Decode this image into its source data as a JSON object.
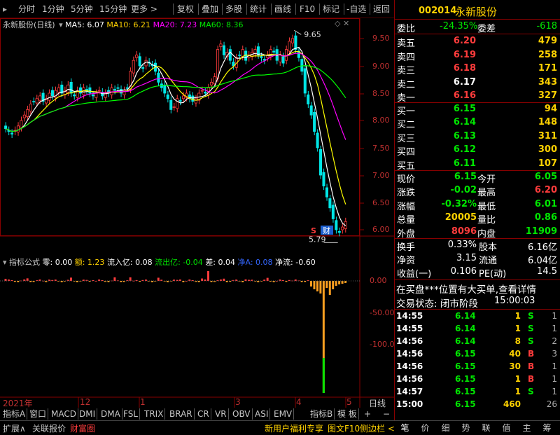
{
  "toolbar": {
    "items": [
      "分时",
      "1分钟",
      "5分钟",
      "15分钟",
      "更多 >",
      "复权",
      "叠加",
      "多股",
      "统计",
      "画线",
      "F10",
      "标记",
      "-自选",
      "返回"
    ]
  },
  "chart_header": {
    "name": "永新股份(日线)",
    "ma5": "MA5: 6.07",
    "ma10": "MA10: 6.21",
    "ma20": "MA20: 7.23",
    "ma60": "MA60: 8.36"
  },
  "indicator_header": {
    "name": "指标公式",
    "ling": "零: 0.00",
    "e": "额: 1.23",
    "liuru": "流入亿: 0.08",
    "liuchu": "流出亿: -0.04",
    "cha": "差: 0.04",
    "jingA": "净A: 0.08",
    "jingliu": "净流: -0.60"
  },
  "price_axis": [
    "9.50",
    "9.00",
    "8.50",
    "8.00",
    "7.50",
    "7.00",
    "6.50",
    "6.00"
  ],
  "ind_axis": [
    "0.00",
    "-50.00",
    "-100.0"
  ],
  "annotations": {
    "high": "9.65",
    "low": "5.79",
    "s_marker": "S",
    "cai_marker": "财"
  },
  "time_axis": {
    "year": "2021年",
    "m12": "12",
    "m1": "1",
    "m3": "3",
    "m4": "4",
    "m5": "5",
    "daily": "日线"
  },
  "bottom_tabs": [
    "指标A",
    "窗口",
    "MACD",
    "DMI",
    "DMA",
    "FSL",
    "TRIX",
    "BRAR",
    "CR",
    "VR",
    "OBV",
    "ASI",
    "EMV",
    "指标B",
    "模 板",
    "+",
    "−"
  ],
  "status_left": [
    "扩展∧",
    "关联报价",
    "财富圈"
  ],
  "status_mid": [
    "新用户福利专享",
    "图文F10",
    "侧边栏 <"
  ],
  "status_right": [
    "笔",
    "价",
    "细",
    "势",
    "联",
    "值",
    "主",
    "筹"
  ],
  "stock": {
    "code": "002014",
    "name": "永新股份"
  },
  "quote": {
    "weibi_label": "委比",
    "weibi": "-24.35%",
    "weicha_label": "委差",
    "weicha": "-618",
    "asks": [
      {
        "label": "卖五",
        "price": "6.20",
        "vol": "479"
      },
      {
        "label": "卖四",
        "price": "6.19",
        "vol": "258"
      },
      {
        "label": "卖三",
        "price": "6.18",
        "vol": "171"
      },
      {
        "label": "卖二",
        "price": "6.17",
        "vol": "343"
      },
      {
        "label": "卖一",
        "price": "6.16",
        "vol": "327"
      }
    ],
    "bids": [
      {
        "label": "买一",
        "price": "6.15",
        "vol": "94"
      },
      {
        "label": "买二",
        "price": "6.14",
        "vol": "148"
      },
      {
        "label": "买三",
        "price": "6.13",
        "vol": "311"
      },
      {
        "label": "买四",
        "price": "6.12",
        "vol": "300"
      },
      {
        "label": "买五",
        "price": "6.11",
        "vol": "107"
      }
    ],
    "stats": [
      {
        "l1": "现价",
        "v1": "6.15",
        "l2": "今开",
        "v2": "6.05",
        "c1": "green",
        "c2": "green"
      },
      {
        "l1": "涨跌",
        "v1": "-0.02",
        "l2": "最高",
        "v2": "6.20",
        "c1": "green",
        "c2": "red"
      },
      {
        "l1": "涨幅",
        "v1": "-0.32%",
        "l2": "最低",
        "v2": "6.01",
        "c1": "green",
        "c2": "green"
      },
      {
        "l1": "总量",
        "v1": "20005",
        "l2": "量比",
        "v2": "0.86",
        "c1": "yellow",
        "c2": "green"
      },
      {
        "l1": "外盘",
        "v1": "8096",
        "l2": "内盘",
        "v2": "11909",
        "c1": "red",
        "c2": "green"
      }
    ],
    "fin": [
      {
        "l1": "换手",
        "v1": "0.33%",
        "l2": "股本",
        "v2": "6.16亿"
      },
      {
        "l1": "净资",
        "v1": "3.15",
        "l2": "流通",
        "v2": "6.04亿"
      },
      {
        "l1": "收益(一)",
        "v1": "0.106",
        "l2": "PE(动)",
        "v2": "14.5"
      }
    ],
    "notice": "在买盘***位置有大买单,查看详情",
    "trade_state_label": "交易状态: 闭市阶段",
    "trade_state_time": "15:00:03"
  },
  "trades": [
    {
      "t": "14:55",
      "p": "6.14",
      "v": "1",
      "d": "S",
      "n": "1"
    },
    {
      "t": "14:55",
      "p": "6.14",
      "v": "1",
      "d": "S",
      "n": "1"
    },
    {
      "t": "14:56",
      "p": "6.14",
      "v": "8",
      "d": "S",
      "n": "2"
    },
    {
      "t": "14:56",
      "p": "6.15",
      "v": "40",
      "d": "B",
      "n": "3"
    },
    {
      "t": "14:56",
      "p": "6.15",
      "v": "30",
      "d": "B",
      "n": "1"
    },
    {
      "t": "14:56",
      "p": "6.15",
      "v": "1",
      "d": "B",
      "n": "1"
    },
    {
      "t": "14:57",
      "p": "6.15",
      "v": "1",
      "d": "S",
      "n": "1"
    },
    {
      "t": "15:00",
      "p": "6.15",
      "v": "460",
      "d": "",
      "n": "26"
    }
  ],
  "colors": {
    "up": "#ff3c3c",
    "down": "#00e600",
    "ma5": "#ffffff",
    "ma10": "#ffff00",
    "ma20": "#ff00ff",
    "ma60": "#00ff00",
    "frame": "#800000"
  }
}
